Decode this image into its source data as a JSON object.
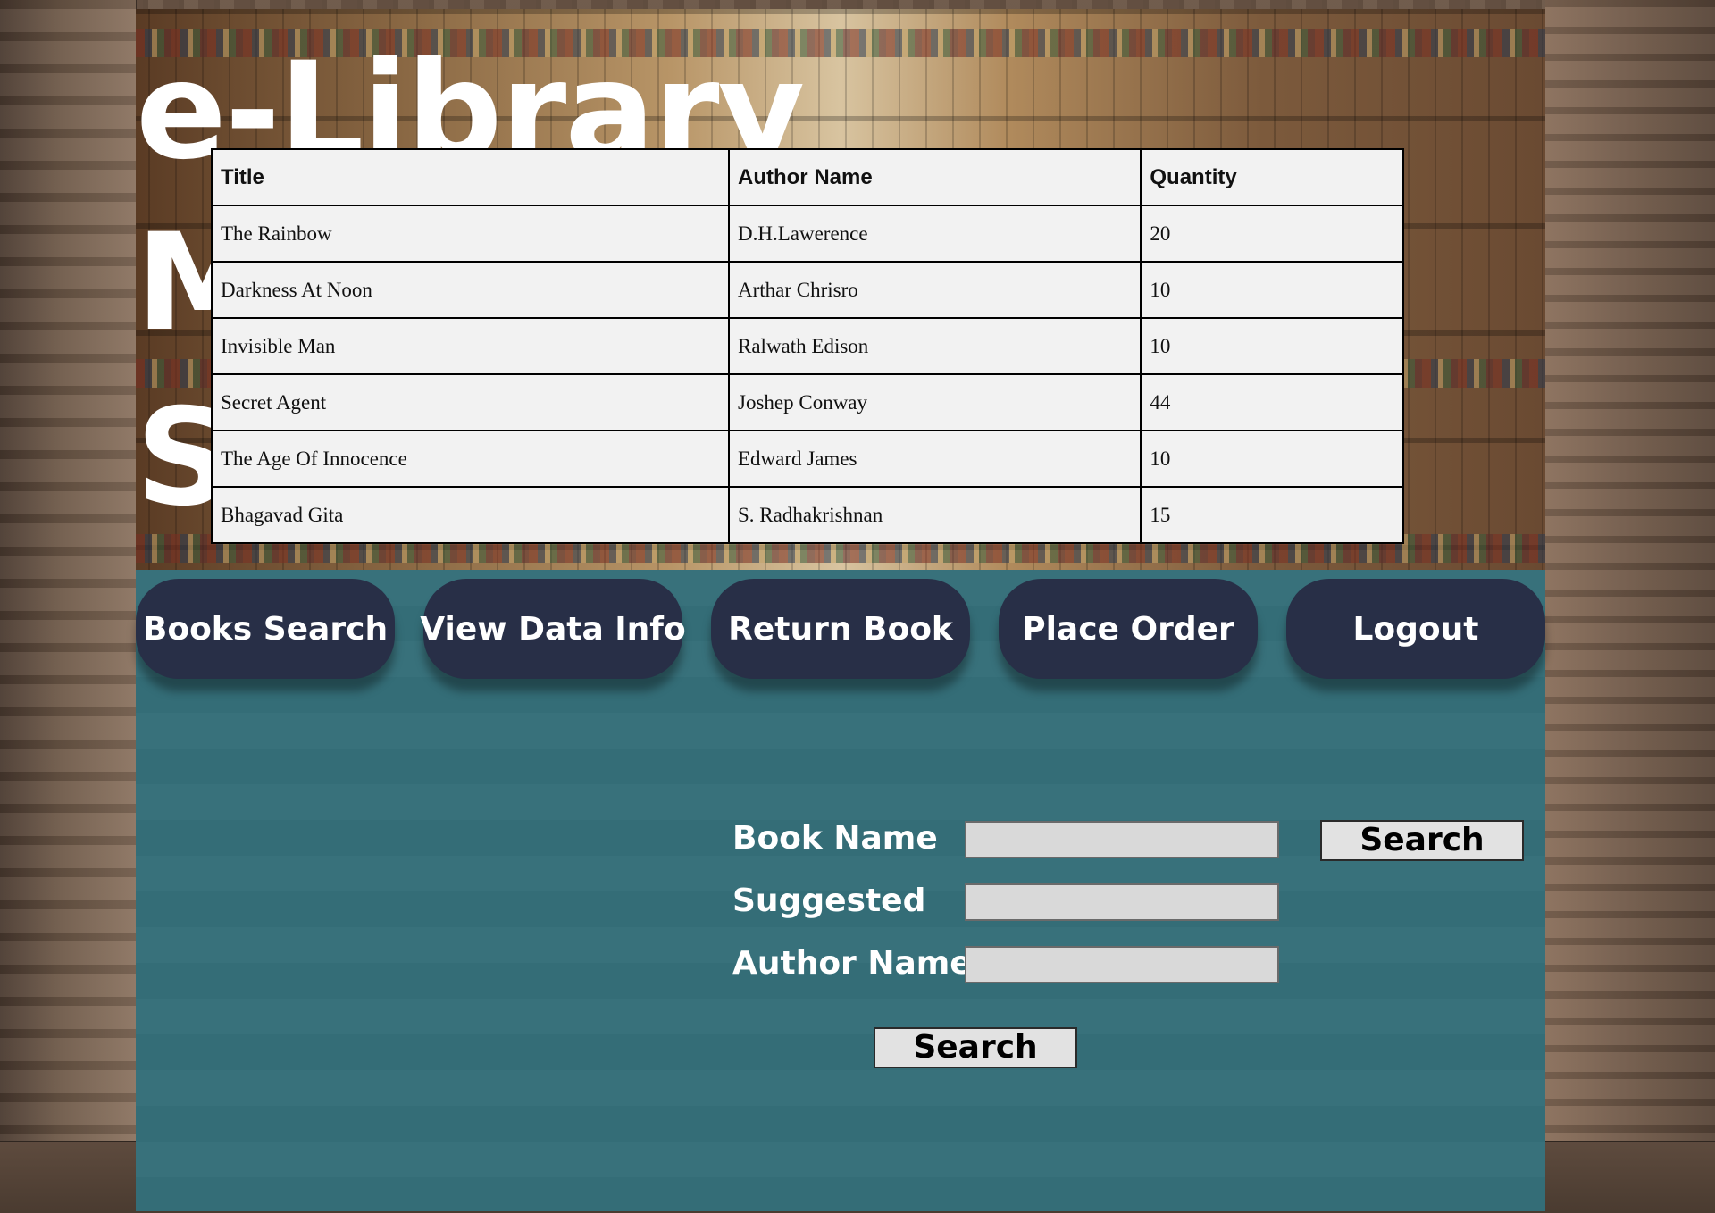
{
  "brand": {
    "line1": "e-Library",
    "line2": "M",
    "line3": "S"
  },
  "table": {
    "headers": [
      "Title",
      "Author Name",
      "Quantity"
    ],
    "rows": [
      [
        "The Rainbow",
        "D.H.Lawerence",
        "20"
      ],
      [
        "Darkness At Noon",
        "Arthar Chrisro",
        "10"
      ],
      [
        "Invisible Man",
        "Ralwath Edison",
        "10"
      ],
      [
        "Secret Agent",
        "Joshep Conway",
        "44"
      ],
      [
        "The Age Of Innocence",
        "Edward James",
        "10"
      ],
      [
        "Bhagavad Gita",
        "S. Radhakrishnan",
        "15"
      ]
    ]
  },
  "nav": {
    "items": [
      {
        "label": "Books Search"
      },
      {
        "label": "View Data Info"
      },
      {
        "label": "Return Book"
      },
      {
        "label": "Place Order"
      },
      {
        "label": "Logout"
      }
    ]
  },
  "form": {
    "book_name_label": "Book Name",
    "book_name_value": "",
    "suggested_label": "Suggested",
    "suggested_value": "",
    "author_name_label": "Author Name",
    "author_name_value": "",
    "search_top_label": "Search",
    "search_bottom_label": "Search"
  },
  "colors": {
    "panel": "#356f79",
    "nav_button": "#282f47",
    "table_bg": "#f2f2f2"
  }
}
